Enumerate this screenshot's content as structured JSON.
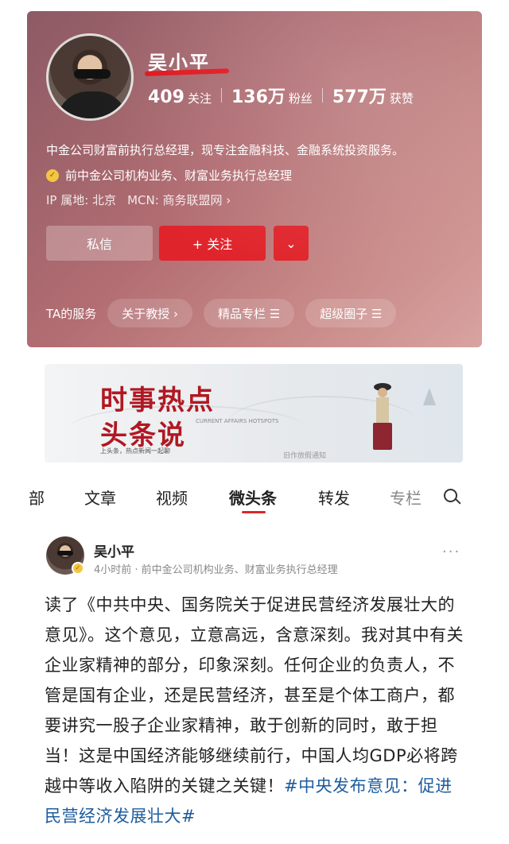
{
  "profile": {
    "name": "吴小平",
    "stats": [
      {
        "num": "409",
        "label": "关注"
      },
      {
        "num": "136万",
        "label": "粉丝"
      },
      {
        "num": "577万",
        "label": "获赞"
      }
    ],
    "bio": "中金公司财富前执行总经理，现专注金融科技、金融系统投资服务。",
    "certification": "前中金公司机构业务、财富业务执行总经理",
    "ip": "IP 属地: 北京",
    "mcn": "MCN: 商务联盟网 ›",
    "buttons": {
      "message": "私信",
      "follow": "+ 关注",
      "more": "⌄"
    },
    "services_title": "TA的服务",
    "services": [
      "关于教授 ›",
      "精品专栏 ☰",
      "超级圈子 ☰"
    ]
  },
  "banner": {
    "title1": "时事热点",
    "title2": "头条说",
    "english": "CURRENT AFFAIRS HOTSPOTS",
    "tagline": "上头条，热点新闻一起聊",
    "caption": "旧作放假通知"
  },
  "tabs": [
    "部",
    "文章",
    "视频",
    "微头条",
    "转发",
    "专栏"
  ],
  "active_tab": "微头条",
  "post": {
    "author": "吴小平",
    "meta": "4小时前 · 前中金公司机构业务、财富业务执行总经理",
    "more": "···",
    "text": "读了《中共中央、国务院关于促进民营经济发展壮大的意见》。这个意见，立意高远，含意深刻。我对其中有关企业家精神的部分，印象深刻。任何企业的负责人，不管是国有企业，还是民营经济，甚至是个体工商户，都要讲究一股子企业家精神，敢于创新的同时，敢于担当！这是中国经济能够继续前行，中国人均GDP必将跨越中等收入陷阱的关键之关键！",
    "hashtag": "#中央发布意见：促进民营经济发展壮大#"
  },
  "colors": {
    "accent": "#e0242b",
    "link": "#1d5c9e"
  }
}
